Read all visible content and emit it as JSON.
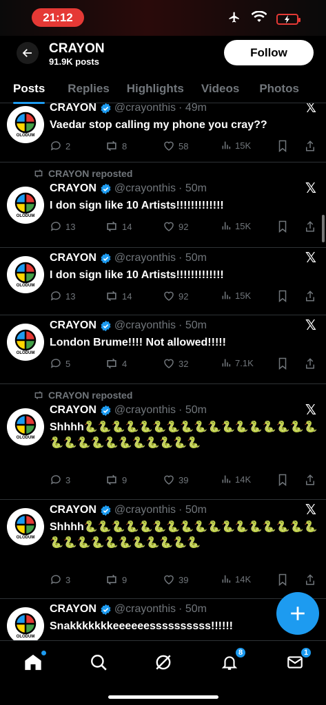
{
  "status_bar": {
    "time": "21:12"
  },
  "header": {
    "name": "CRAYON",
    "post_count": "91.9K posts",
    "follow_label": "Follow"
  },
  "tabs": [
    "Posts",
    "Replies",
    "Highlights",
    "Videos",
    "Photos"
  ],
  "repost_label": "CRAYON reposted",
  "avatar_text": "OLODUM",
  "posts": [
    {
      "name": "CRAYON",
      "handle": "@crayonthis",
      "time": "· 49m",
      "reposted": false,
      "text": "Vaedar stop calling my phone you cray??",
      "replies": "2",
      "reposts": "8",
      "likes": "58",
      "views": "15K"
    },
    {
      "name": "CRAYON",
      "handle": "@crayonthis",
      "time": "· 50m",
      "reposted": true,
      "text": "I don sign like 10 Artists!!!!!!!!!!!!!",
      "replies": "13",
      "reposts": "14",
      "likes": "92",
      "views": "15K"
    },
    {
      "name": "CRAYON",
      "handle": "@crayonthis",
      "time": "· 50m",
      "reposted": false,
      "text": "I don sign like 10 Artists!!!!!!!!!!!!!",
      "replies": "13",
      "reposts": "14",
      "likes": "92",
      "views": "15K"
    },
    {
      "name": "CRAYON",
      "handle": "@crayonthis",
      "time": "· 50m",
      "reposted": false,
      "text": "London Brume!!!! Not allowed!!!!!",
      "replies": "5",
      "reposts": "4",
      "likes": "32",
      "views": "7.1K"
    },
    {
      "name": "CRAYON",
      "handle": "@crayonthis",
      "time": "· 50m",
      "reposted": true,
      "text": "Shhhh🐍🐍🐍🐍🐍🐍🐍🐍🐍🐍🐍🐍🐍🐍🐍🐍🐍🐍🐍🐍🐍🐍🐍🐍🐍🐍🐍🐍",
      "replies": "3",
      "reposts": "9",
      "likes": "39",
      "views": "14K"
    },
    {
      "name": "CRAYON",
      "handle": "@crayonthis",
      "time": "· 50m",
      "reposted": false,
      "text": "Shhhh🐍🐍🐍🐍🐍🐍🐍🐍🐍🐍🐍🐍🐍🐍🐍🐍🐍🐍🐍🐍🐍🐍🐍🐍🐍🐍🐍🐍",
      "replies": "3",
      "reposts": "9",
      "likes": "39",
      "views": "14K"
    },
    {
      "name": "CRAYON",
      "handle": "@crayonthis",
      "time": "· 50m",
      "reposted": false,
      "text": "Snakkkkkkkeeeeeessssssssss!!!!!!"
    }
  ],
  "nav_badges": {
    "notifications": "8",
    "messages": "1"
  },
  "colors": {
    "accent": "#1d9bf0",
    "time_pill": "#e53935",
    "muted": "#71767b"
  }
}
